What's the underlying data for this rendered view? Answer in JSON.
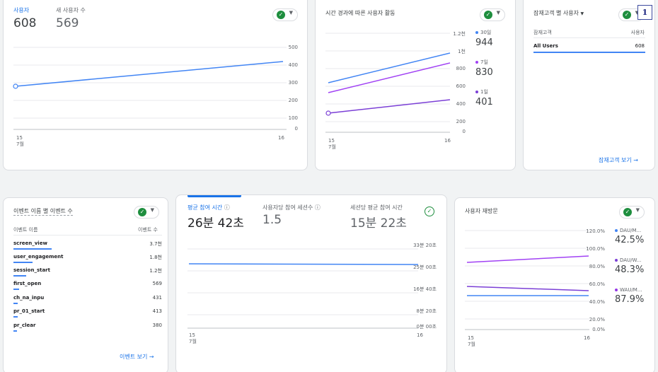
{
  "card_users": {
    "metric1_label": "사용자",
    "metric1_value": "608",
    "metric2_label": "새 사용자 수",
    "metric2_value": "569",
    "y_ticks": [
      "500",
      "400",
      "300",
      "200",
      "100",
      "0"
    ],
    "x_tick1": "15",
    "x_tick1_sub": "7월",
    "x_tick2": "16"
  },
  "card_activity": {
    "title": "시간 경과에 따른 사용자 활동",
    "y_ticks": [
      "1.2천",
      "1천",
      "800",
      "600",
      "400",
      "200",
      "0"
    ],
    "x_tick1": "15",
    "x_tick1_sub": "7월",
    "x_tick2": "16",
    "legend": [
      {
        "label": "30일",
        "value": "944",
        "color": "#4285f4"
      },
      {
        "label": "7일",
        "value": "830",
        "color": "#9334e6"
      },
      {
        "label": "1일",
        "value": "401",
        "color": "#7b3fd6"
      }
    ]
  },
  "card_audience": {
    "title": "잠재고객 별 사용자",
    "col1": "잠재고객",
    "col2": "사용자",
    "row_name": "All Users",
    "row_value": "608",
    "link": "잠재고객 보기",
    "badge": "1"
  },
  "card_events": {
    "title": "이벤트 이름 별 이벤트 수",
    "col1": "이벤트 이름",
    "col2": "이벤트 수",
    "rows": [
      {
        "name": "screen_view",
        "value": "3.7천"
      },
      {
        "name": "user_engagement",
        "value": "1.8천"
      },
      {
        "name": "session_start",
        "value": "1.2천"
      },
      {
        "name": "first_open",
        "value": "569"
      },
      {
        "name": "ch_na_inpu",
        "value": "431"
      },
      {
        "name": "pr_01_start",
        "value": "413"
      },
      {
        "name": "pr_clear",
        "value": "380"
      }
    ],
    "link": "이벤트 보기"
  },
  "card_engagement": {
    "tab1_label": "평균 참여 시간",
    "tab1_value": "26분 42초",
    "tab2_label": "사용자당 참여 세션수",
    "tab2_value": "1.5",
    "tab3_label": "세션당 평균 참여 시간",
    "tab3_value": "15분 22초",
    "y_ticks": [
      "33분 20초",
      "25분 00초",
      "16분 40초",
      "8분 20초",
      "0분 00초"
    ],
    "x_tick1": "15",
    "x_tick1_sub": "7월",
    "x_tick2": "16"
  },
  "card_retention": {
    "title": "사용자 재방문",
    "y_ticks": [
      "120.0%",
      "100.0%",
      "80.0%",
      "60.0%",
      "40.0%",
      "20.0%",
      "0.0%"
    ],
    "x_tick1": "15",
    "x_tick1_sub": "7월",
    "x_tick2": "16",
    "legend": [
      {
        "label": "DAU/M...",
        "value": "42.5%",
        "color": "#4285f4"
      },
      {
        "label": "DAU/W...",
        "value": "48.3%",
        "color": "#7b3fd6"
      },
      {
        "label": "WAU/M...",
        "value": "87.9%",
        "color": "#9334e6"
      }
    ]
  },
  "check_icon": "check-circle-icon",
  "accent": "#1a73e8"
}
